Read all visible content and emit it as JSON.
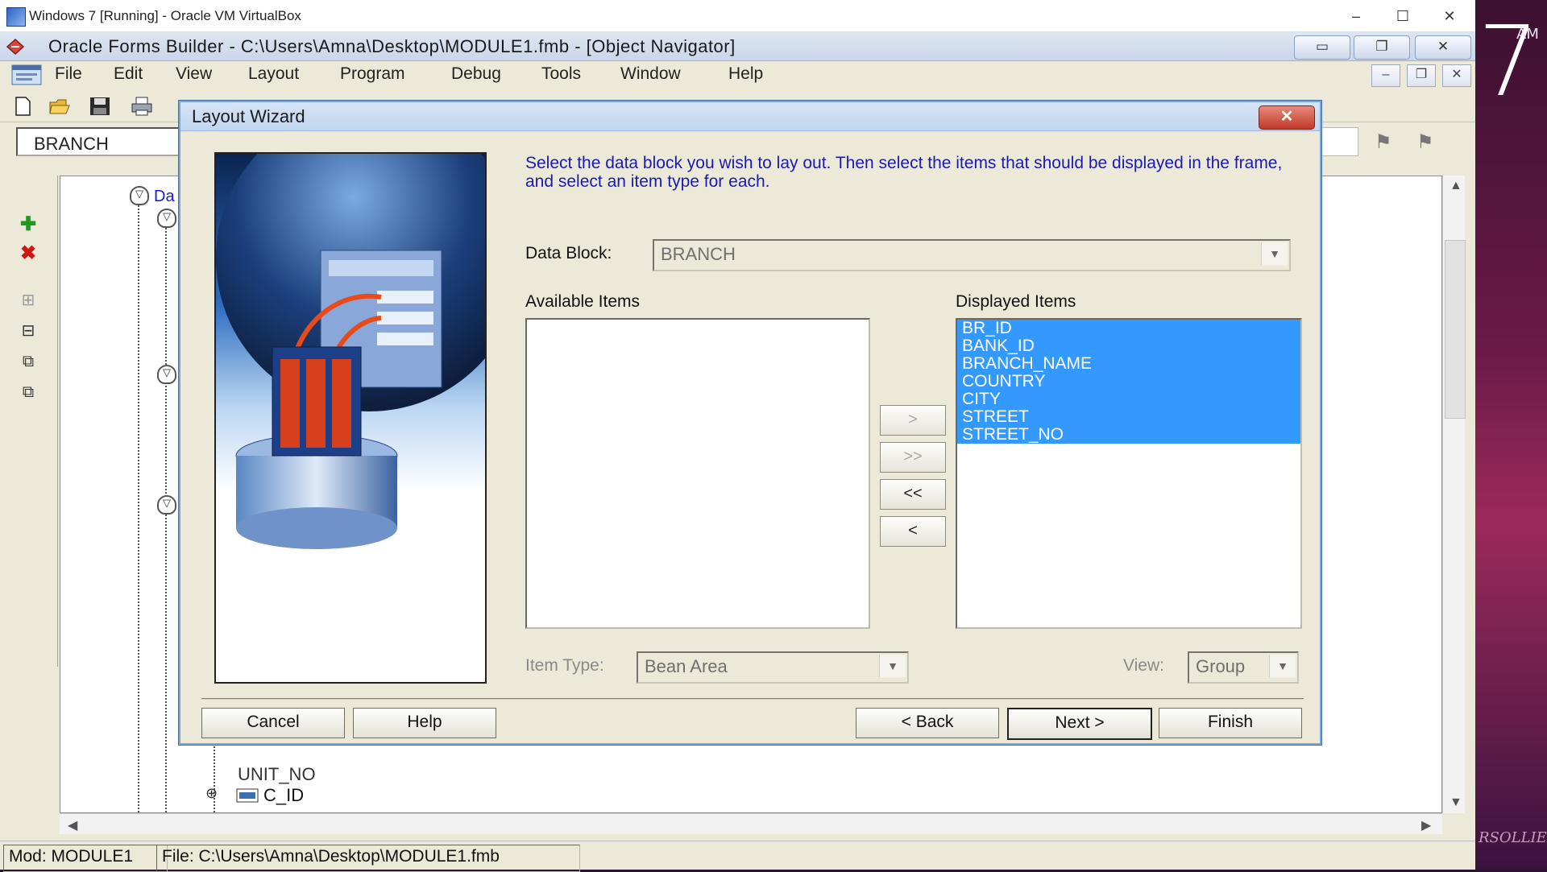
{
  "host": {
    "title": "Windows 7 [Running] - Oracle VM VirtualBox",
    "controls": {
      "minimize": "–",
      "maximize": "☐",
      "close": "✕"
    }
  },
  "desktop": {
    "clock_suffix": "AM",
    "clock_digit": "7",
    "signature": "RSOLLIER"
  },
  "app": {
    "title": "Oracle Forms Builder - C:\\Users\\Amna\\Desktop\\MODULE1.fmb - [Object Navigator]",
    "menu": [
      "File",
      "Edit",
      "View",
      "Layout",
      "Program",
      "Debug",
      "Tools",
      "Window",
      "Help"
    ],
    "navigator_field": "BRANCH",
    "tree": {
      "top_label": "Da",
      "bottom_items": [
        "UNIT_NO",
        "C_ID"
      ]
    },
    "status": {
      "module": "Mod: MODULE1",
      "file": "File: C:\\Users\\Amna\\Desktop\\MODULE1.fmb"
    }
  },
  "wizard": {
    "title": "Layout Wizard",
    "close": "✕",
    "instructions": "Select the data block you wish to lay out. Then select the items that should be displayed in the frame, and select an item type for each.",
    "data_block_label": "Data Block:",
    "data_block_value": "BRANCH",
    "available_label": "Available Items",
    "available_items": [],
    "displayed_label": "Displayed Items",
    "displayed_items": [
      "BR_ID",
      "BANK_ID",
      "BRANCH_NAME",
      "COUNTRY",
      "CITY",
      "STREET",
      "STREET_NO"
    ],
    "move_buttons": [
      ">",
      ">>",
      "<<",
      "<"
    ],
    "item_type_label": "Item Type:",
    "item_type_value": "Bean Area",
    "view_label": "View:",
    "view_value": "Group",
    "buttons": {
      "cancel": "Cancel",
      "help": "Help",
      "back": "< Back",
      "next": "Next >",
      "finish": "Finish"
    }
  },
  "colors": {
    "selection": "#3399ff",
    "instruction_text": "#1a1ab4",
    "dialog_bg": "#ece9d8"
  }
}
